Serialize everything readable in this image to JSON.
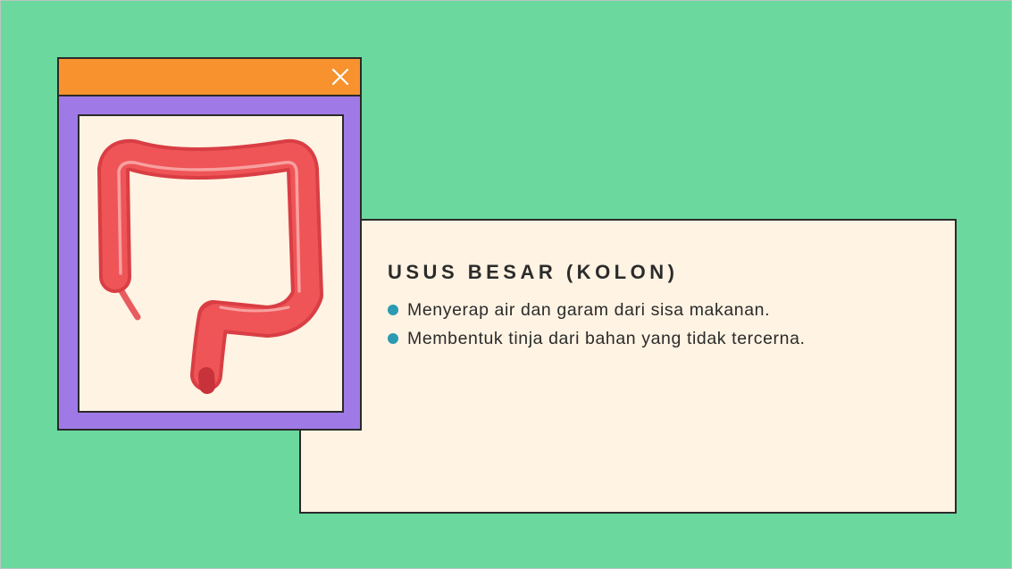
{
  "colors": {
    "background": "#6bd89d",
    "card": "#fff3e3",
    "window_frame": "#9f7ae6",
    "titlebar": "#f7922e",
    "bullet": "#2b9ab2",
    "colon": "#e0484b"
  },
  "window": {
    "close_icon": "close-icon"
  },
  "illustration": {
    "icon": "large-intestine-illustration"
  },
  "content": {
    "title": "USUS BESAR (KOLON)",
    "bullets": [
      "Menyerap air dan garam dari sisa makanan.",
      "Membentuk tinja dari bahan yang tidak tercerna."
    ]
  }
}
